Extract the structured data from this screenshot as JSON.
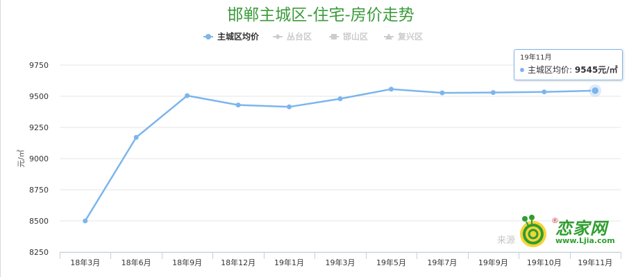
{
  "chart_data": {
    "type": "line",
    "title": "邯郸主城区-住宅-房价走势",
    "ylabel": "元/㎡",
    "categories": [
      "18年3月",
      "18年6月",
      "18年9月",
      "18年12月",
      "19年1月",
      "19年3月",
      "19年5月",
      "19年7月",
      "19年9月",
      "19年10月",
      "19年11月"
    ],
    "series": [
      {
        "name": "主城区均价",
        "values": [
          8500,
          9170,
          9505,
          9430,
          9415,
          9480,
          9557,
          9527,
          9530,
          9535,
          9545
        ],
        "color": "#7cb5ec"
      },
      {
        "name": "丛台区",
        "values": [],
        "color": "#cccccc"
      },
      {
        "name": "邯山区",
        "values": [],
        "color": "#cccccc"
      },
      {
        "name": "复兴区",
        "values": [],
        "color": "#cccccc"
      }
    ],
    "ylim": [
      8250,
      9750
    ],
    "yticks": [
      8250,
      8500,
      8750,
      9000,
      9250,
      9500,
      9750
    ],
    "grid": true,
    "legend_position": "top-center",
    "tooltip": {
      "date": "19年11月",
      "series": "主城区均价",
      "separator": ":",
      "value": "9545元/㎡"
    }
  },
  "watermark": {
    "source": "来源",
    "brand": "恋家网",
    "url": "www.Ljia.com",
    "registered": "®"
  }
}
